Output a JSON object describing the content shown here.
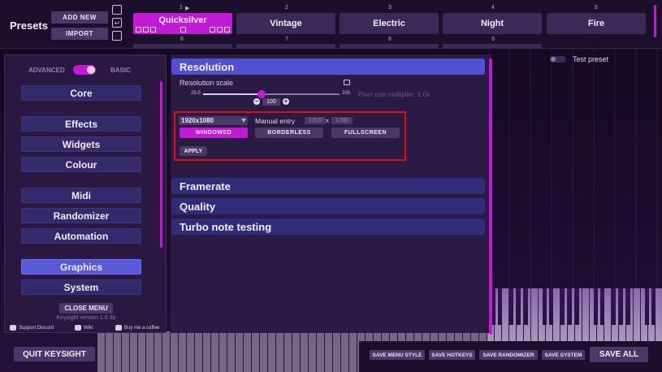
{
  "presets": {
    "title": "Presets",
    "add_new_label": "ADD NEW",
    "import_label": "IMPORT",
    "side_icons": [
      "folder-icon",
      "undo-icon",
      "save-icon"
    ],
    "slots": [
      {
        "num": "1",
        "name": "Quicksilver",
        "active": true
      },
      {
        "num": "2",
        "name": "Vintage"
      },
      {
        "num": "3",
        "name": "Electric"
      },
      {
        "num": "4",
        "name": "Night"
      },
      {
        "num": "5",
        "name": "Fire"
      }
    ],
    "row2_nums": [
      "6",
      "7",
      "8",
      "9"
    ]
  },
  "sidebar": {
    "advanced_label": "ADVANCED",
    "basic_label": "BASIC",
    "mode_toggle_on": true,
    "items": [
      {
        "label": "Core"
      },
      {
        "label": "Effects"
      },
      {
        "label": "Widgets"
      },
      {
        "label": "Colour"
      },
      {
        "label": "Midi"
      },
      {
        "label": "Randomizer"
      },
      {
        "label": "Automation"
      },
      {
        "label": "Graphics",
        "active": true
      },
      {
        "label": "System"
      }
    ],
    "close_menu_label": "CLOSE MENU",
    "version": "Keysight version 1.6.3b",
    "links": {
      "discord": "Support Discord",
      "wiki": "Wiki",
      "coffee": "Buy me a coffee"
    }
  },
  "main": {
    "sections": {
      "resolution": "Resolution",
      "framerate": "Framerate",
      "quality": "Quality",
      "turbo": "Turbo note testing"
    },
    "resolution": {
      "scale_label": "Resolution scale",
      "slider_min": "25.0",
      "slider_max": "200",
      "slider_value": "100",
      "slider_fraction": 0.43,
      "pixel_cost": "Pixel cost multiplier: 1.0x",
      "selected_resolution": "1920x1080",
      "manual_entry_label": "Manual entry",
      "manual_width": "1,920",
      "manual_x": "x",
      "manual_height": "1,080",
      "modes": {
        "windowed": "WINDOWED",
        "borderless": "BORDERLESS",
        "fullscreen": "FULLSCREEN"
      },
      "active_mode": "windowed",
      "apply_label": "APPLY"
    }
  },
  "test_preset_label": "Test preset",
  "bottom": {
    "quit_label": "QUIT KEYSIGHT",
    "save_menu_style": "SAVE MENU STYLE",
    "save_hotkeys": "SAVE HOTKEYS",
    "save_randomizer": "SAVE RANDOMIZER",
    "save_system": "SAVE SYSTEM",
    "save_all": "SAVE ALL"
  },
  "colors": {
    "accent": "#c01ad6",
    "section_active": "#5050d0",
    "section": "#2f2d7a",
    "button": "#4a3868",
    "highlight_box": "#e01010"
  }
}
